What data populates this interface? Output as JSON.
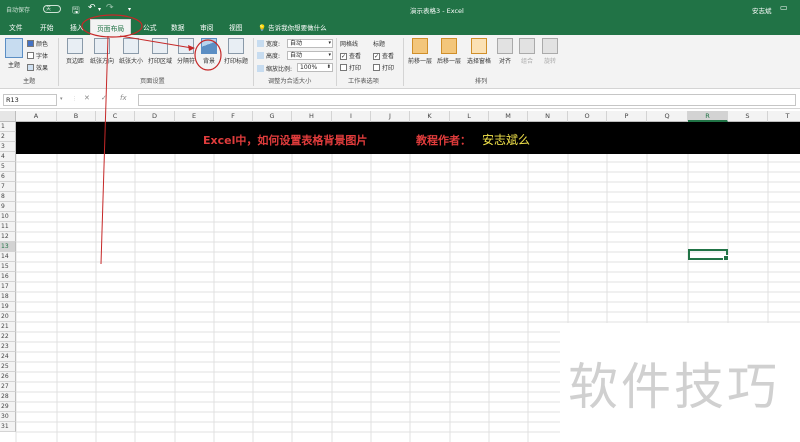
{
  "titlebar": {
    "autosave_label": "自动保存",
    "autosave_state": "关",
    "doc_title": "演示表格3  -  Excel",
    "user": "安志斌",
    "colors": {
      "brand": "#217346"
    }
  },
  "tabs": [
    {
      "label": "文件",
      "active": false
    },
    {
      "label": "开始",
      "active": false
    },
    {
      "label": "插入",
      "active": false
    },
    {
      "label": "页面布局",
      "active": true
    },
    {
      "label": "公式",
      "active": false
    },
    {
      "label": "数据",
      "active": false
    },
    {
      "label": "审阅",
      "active": false
    },
    {
      "label": "视图",
      "active": false
    }
  ],
  "tellme": "告诉我你想要做什么",
  "ribbon": {
    "themes": {
      "theme": "主题",
      "colors": "颜色",
      "fonts": "字体",
      "effects": "效果",
      "group": "主题"
    },
    "page_setup": {
      "margins": "页边距",
      "orientation": "纸张方向",
      "size": "纸张大小",
      "print_area": "打印区域",
      "breaks": "分隔符",
      "background": "背景",
      "print_titles": "打印标题",
      "group": "页面设置"
    },
    "scale": {
      "width_label": "宽度:",
      "width_value": "自动",
      "height_label": "高度:",
      "height_value": "自动",
      "scale_label": "缩放比例:",
      "scale_value": "100%",
      "group": "调整为合适大小"
    },
    "sheet_options": {
      "gridlines": "网格线",
      "headings": "标题",
      "view": "查看",
      "print": "打印",
      "group": "工作表选项"
    },
    "arrange": {
      "bring_forward": "前移一层",
      "send_backward": "后移一层",
      "selection_pane": "选择窗格",
      "align": "对齐",
      "group_btn": "组合",
      "rotate": "旋转",
      "group": "排列"
    }
  },
  "formula_bar": {
    "name_box": "R13",
    "fx": "fx",
    "content": ""
  },
  "columns": [
    "A",
    "B",
    "C",
    "D",
    "E",
    "F",
    "G",
    "H",
    "I",
    "J",
    "K",
    "L",
    "M",
    "N",
    "O",
    "P",
    "Q",
    "R",
    "S",
    "T"
  ],
  "selected_column": "R",
  "rows": [
    "1",
    "2",
    "3",
    "4",
    "5",
    "6",
    "7",
    "8",
    "9",
    "10",
    "11",
    "12",
    "13",
    "14",
    "15",
    "16",
    "17",
    "18",
    "19",
    "20",
    "21",
    "22",
    "23",
    "24",
    "25",
    "26",
    "27",
    "28",
    "29",
    "30",
    "31"
  ],
  "selected_row": "13",
  "banner": {
    "text1": "Excel中，如何设置表格背景图片",
    "text2": "教程作者：",
    "text3": "安志斌么",
    "colors": {
      "bg": "#000000",
      "red": "#e03c3c",
      "yellow": "#f1e24a"
    }
  },
  "watermark": "软件技巧"
}
